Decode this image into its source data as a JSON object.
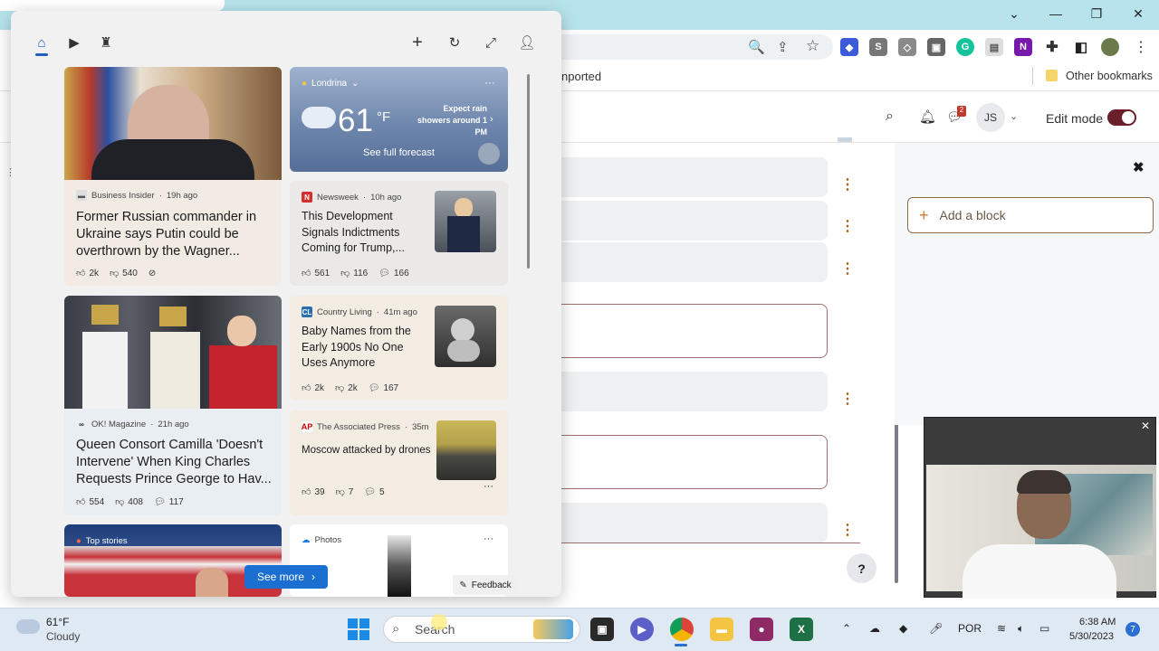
{
  "browser": {
    "bookmarks": {
      "imported": "nported",
      "other": "Other bookmarks"
    },
    "win_controls": [
      "⌄",
      "—",
      "❐",
      "✕"
    ]
  },
  "moodle": {
    "user_initials": "JS",
    "edit_mode_label": "Edit mode",
    "notification_count": "2",
    "add_block_label": "Add a block",
    "help": "?"
  },
  "widgets": {
    "weather": {
      "location": "Londrina",
      "temp": "61",
      "unit": "°F",
      "forecast_note": "Expect rain showers around 1 PM",
      "forecast_link": "See full forecast"
    },
    "cards": [
      {
        "source": "Business Insider",
        "age": "19h ago",
        "headline": "Former Russian commander in Ukraine says Putin could be overthrown by the Wagner...",
        "likes": "2k",
        "dislikes": "540"
      },
      {
        "source": "Newsweek",
        "age": "10h ago",
        "headline": "This Development Signals Indictments Coming for Trump,...",
        "likes": "561",
        "dislikes": "116",
        "comments": "166"
      },
      {
        "source": "Country Living",
        "age": "41m ago",
        "headline": "Baby Names from the Early 1900s No One Uses Anymore",
        "likes": "2k",
        "dislikes": "2k",
        "comments": "167"
      },
      {
        "source": "OK! Magazine",
        "age": "21h ago",
        "headline": "Queen Consort Camilla 'Doesn't Intervene' When King Charles Requests Prince George to Hav...",
        "likes": "554",
        "dislikes": "408",
        "comments": "117"
      },
      {
        "source": "The Associated Press",
        "age": "35m",
        "headline": "Moscow attacked by drones",
        "likes": "39",
        "dislikes": "7",
        "comments": "5"
      },
      {
        "source": "Top stories",
        "headline": ""
      },
      {
        "source": "Photos",
        "headline": ""
      }
    ],
    "see_more": "See more",
    "feedback": "Feedback"
  },
  "taskbar": {
    "weather_temp": "61°F",
    "weather_desc": "Cloudy",
    "search_placeholder": "Search",
    "lang": "POR",
    "time": "6:38 AM",
    "date": "5/30/2023",
    "notif_count": "7"
  }
}
